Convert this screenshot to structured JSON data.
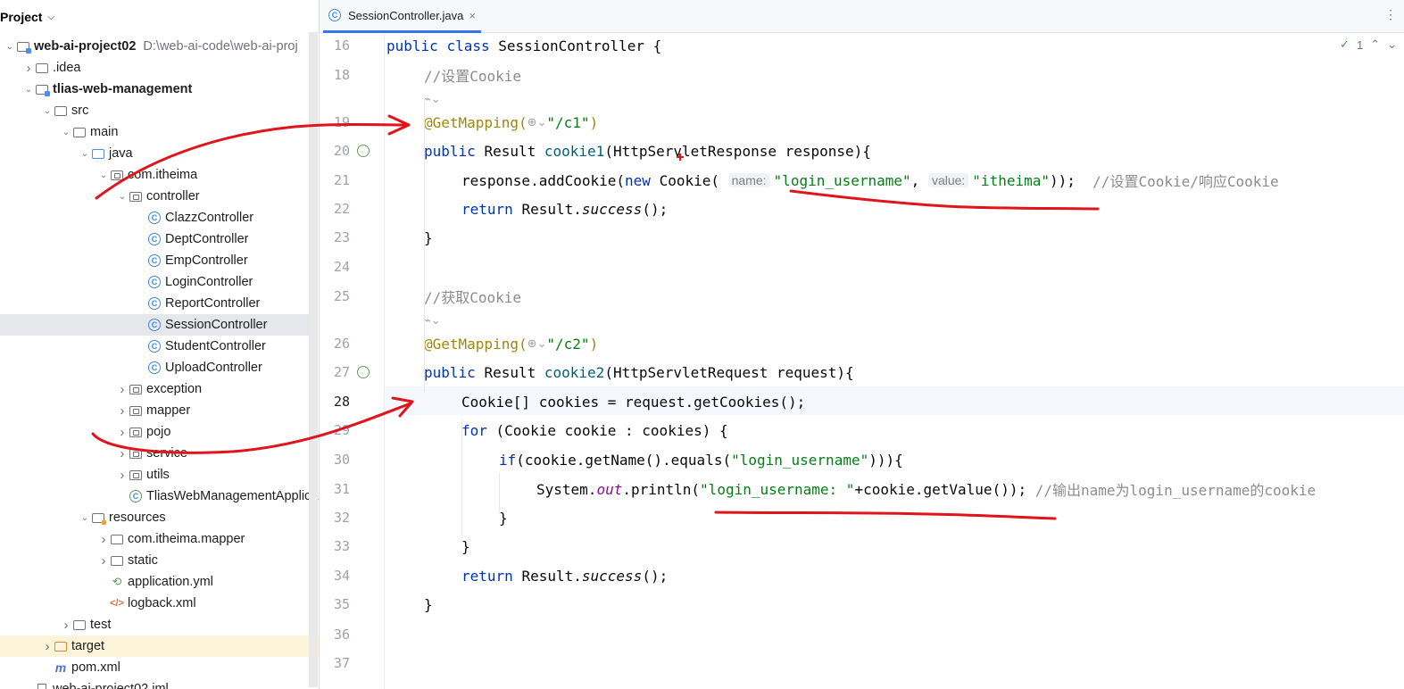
{
  "sidebar": {
    "title": "Project",
    "tree": [
      {
        "label": "web-ai-project02",
        "path": "D:\\web-ai-code\\web-ai-proj",
        "icon": "module-folder-icon",
        "depth": 0,
        "arrow": "down",
        "bold": true
      },
      {
        "label": ".idea",
        "icon": "folder-icon",
        "depth": 1,
        "arrow": "right"
      },
      {
        "label": "tlias-web-management",
        "icon": "module-folder-icon",
        "depth": 1,
        "arrow": "down",
        "bold": true
      },
      {
        "label": "src",
        "icon": "folder-icon",
        "depth": 2,
        "arrow": "down"
      },
      {
        "label": "main",
        "icon": "folder-icon",
        "depth": 3,
        "arrow": "down"
      },
      {
        "label": "java",
        "icon": "source-folder-icon",
        "depth": 4,
        "arrow": "down"
      },
      {
        "label": "com.itheima",
        "icon": "package-icon",
        "depth": 5,
        "arrow": "down"
      },
      {
        "label": "controller",
        "icon": "package-icon",
        "depth": 6,
        "arrow": "down"
      },
      {
        "label": "ClazzController",
        "icon": "class-icon",
        "depth": 7,
        "arrow": ""
      },
      {
        "label": "DeptController",
        "icon": "class-icon",
        "depth": 7,
        "arrow": ""
      },
      {
        "label": "EmpController",
        "icon": "class-icon",
        "depth": 7,
        "arrow": ""
      },
      {
        "label": "LoginController",
        "icon": "class-icon",
        "depth": 7,
        "arrow": ""
      },
      {
        "label": "ReportController",
        "icon": "class-icon",
        "depth": 7,
        "arrow": ""
      },
      {
        "label": "SessionController",
        "icon": "class-icon",
        "depth": 7,
        "arrow": "",
        "selected": true
      },
      {
        "label": "StudentController",
        "icon": "class-icon",
        "depth": 7,
        "arrow": ""
      },
      {
        "label": "UploadController",
        "icon": "class-icon",
        "depth": 7,
        "arrow": ""
      },
      {
        "label": "exception",
        "icon": "package-icon",
        "depth": 6,
        "arrow": "right"
      },
      {
        "label": "mapper",
        "icon": "package-icon",
        "depth": 6,
        "arrow": "right"
      },
      {
        "label": "pojo",
        "icon": "package-icon",
        "depth": 6,
        "arrow": "right"
      },
      {
        "label": "service",
        "icon": "package-icon",
        "depth": 6,
        "arrow": "right"
      },
      {
        "label": "utils",
        "icon": "package-icon",
        "depth": 6,
        "arrow": "right"
      },
      {
        "label": "TliasWebManagementApplica",
        "icon": "spring-class-icon",
        "depth": 6,
        "arrow": ""
      },
      {
        "label": "resources",
        "icon": "resources-folder-icon",
        "depth": 4,
        "arrow": "down"
      },
      {
        "label": "com.itheima.mapper",
        "icon": "folder-icon",
        "depth": 5,
        "arrow": "right"
      },
      {
        "label": "static",
        "icon": "folder-icon",
        "depth": 5,
        "arrow": "right"
      },
      {
        "label": "application.yml",
        "icon": "yaml-file-icon",
        "depth": 5,
        "arrow": ""
      },
      {
        "label": "logback.xml",
        "icon": "xml-file-icon",
        "depth": 5,
        "arrow": ""
      },
      {
        "label": "test",
        "icon": "folder-icon",
        "depth": 3,
        "arrow": "right"
      },
      {
        "label": "target",
        "icon": "target-folder-icon",
        "depth": 2,
        "arrow": "right",
        "highlight": true
      },
      {
        "label": "pom.xml",
        "icon": "maven-file-icon",
        "depth": 2,
        "arrow": ""
      },
      {
        "label": "web-ai-project02.iml",
        "icon": "file-icon",
        "depth": 1,
        "arrow": ""
      }
    ]
  },
  "editor": {
    "tab_label": "SessionController.java",
    "tab_close": "×",
    "menu": "⋮",
    "inspection": {
      "check": "✓",
      "count": "1",
      "up": "⌃",
      "down": "⌄"
    },
    "current_line": "28",
    "lines": [
      {
        "n": "16",
        "code": [
          [
            "kw",
            "public "
          ],
          [
            "kw",
            "class "
          ],
          [
            "",
            "SessionController {"
          ]
        ],
        "indent": 0
      },
      {
        "n": "18",
        "code": [
          [
            "cmt",
            "//设置Cookie"
          ]
        ],
        "indent": 1
      },
      {
        "n": "",
        "code": [
          [
            "ico",
            "⌁⌄"
          ]
        ],
        "indent": 1
      },
      {
        "n": "19",
        "code": [
          [
            "ann",
            "@GetMapping("
          ],
          [
            "ico",
            "⊕⌄"
          ],
          [
            "str",
            "\"/c1\""
          ],
          [
            "ann",
            ")"
          ]
        ],
        "indent": 1
      },
      {
        "n": "20",
        "code": [
          [
            "kw",
            "public "
          ],
          [
            "",
            "Result "
          ],
          [
            "mth",
            "cookie1"
          ],
          [
            "",
            "(HttpServletResponse response){"
          ]
        ],
        "indent": 1,
        "spring": true
      },
      {
        "n": "21",
        "code": [
          [
            "",
            "response.addCookie("
          ],
          [
            "kw",
            "new "
          ],
          [
            "",
            "Cookie( "
          ],
          [
            "hint",
            "name:"
          ],
          [
            "str",
            "\"login_username\""
          ],
          [
            "",
            ", "
          ],
          [
            "hint",
            "value:"
          ],
          [
            "str",
            "\"itheima\""
          ],
          [
            "",
            "));  "
          ],
          [
            "cmt",
            "//设置Cookie/响应Cookie"
          ]
        ],
        "indent": 2
      },
      {
        "n": "22",
        "code": [
          [
            "kw",
            "return "
          ],
          [
            "",
            "Result."
          ],
          [
            "it",
            "success"
          ],
          [
            "",
            "();"
          ]
        ],
        "indent": 2
      },
      {
        "n": "23",
        "code": [
          [
            "",
            "}"
          ]
        ],
        "indent": 1
      },
      {
        "n": "24",
        "code": [],
        "indent": 0
      },
      {
        "n": "25",
        "code": [
          [
            "cmt",
            "//获取Cookie"
          ]
        ],
        "indent": 1
      },
      {
        "n": "",
        "code": [
          [
            "ico",
            "⌁⌄"
          ]
        ],
        "indent": 1
      },
      {
        "n": "26",
        "code": [
          [
            "ann",
            "@GetMapping("
          ],
          [
            "ico",
            "⊕⌄"
          ],
          [
            "str",
            "\"/c2\""
          ],
          [
            "ann",
            ")"
          ]
        ],
        "indent": 1
      },
      {
        "n": "27",
        "code": [
          [
            "kw",
            "public "
          ],
          [
            "",
            "Result "
          ],
          [
            "mth",
            "cookie2"
          ],
          [
            "",
            "(HttpServletRequest request){"
          ]
        ],
        "indent": 1,
        "spring": true
      },
      {
        "n": "28",
        "code": [
          [
            "",
            "Cookie[] cookies = request.getCookies();"
          ]
        ],
        "indent": 2
      },
      {
        "n": "29",
        "code": [
          [
            "kw",
            "for "
          ],
          [
            "",
            "(Cookie cookie : cookies) {"
          ]
        ],
        "indent": 2
      },
      {
        "n": "30",
        "code": [
          [
            "kw",
            "if"
          ],
          [
            "",
            "(cookie.getName().equals("
          ],
          [
            "str",
            "\"login_username\""
          ],
          [
            "",
            "))){"
          ]
        ],
        "indent": 3
      },
      {
        "n": "31",
        "code": [
          [
            "",
            "System."
          ],
          [
            "fld",
            "out"
          ],
          [
            "",
            ".println("
          ],
          [
            "str",
            "\"login_username: \""
          ],
          [
            "",
            "+cookie.getValue()); "
          ],
          [
            "cmt",
            "//输出name为login_username的cookie"
          ]
        ],
        "indent": 4
      },
      {
        "n": "32",
        "code": [
          [
            "",
            "}"
          ]
        ],
        "indent": 3
      },
      {
        "n": "33",
        "code": [
          [
            "",
            "}"
          ]
        ],
        "indent": 2
      },
      {
        "n": "34",
        "code": [
          [
            "kw",
            "return "
          ],
          [
            "",
            "Result."
          ],
          [
            "it",
            "success"
          ],
          [
            "",
            "();"
          ]
        ],
        "indent": 2
      },
      {
        "n": "35",
        "code": [
          [
            "",
            "}"
          ]
        ],
        "indent": 1
      },
      {
        "n": "36",
        "code": [],
        "indent": 0
      },
      {
        "n": "37",
        "code": [],
        "indent": 0
      }
    ]
  },
  "annotations": {
    "ink_color": "#e0151b"
  }
}
